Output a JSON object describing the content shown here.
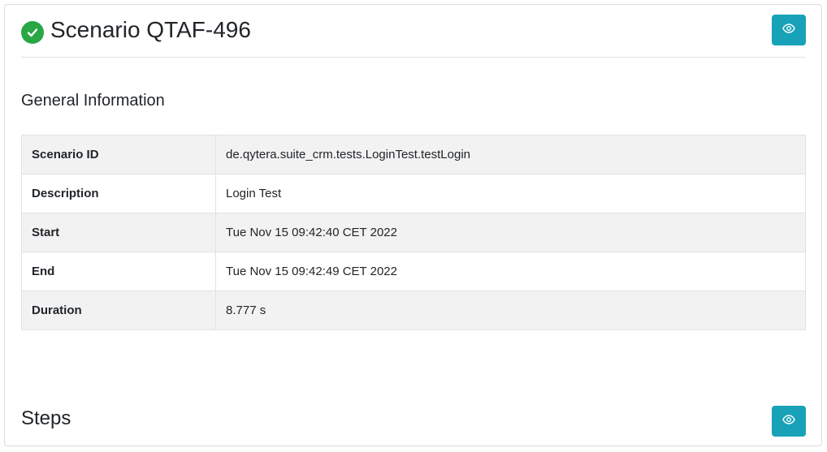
{
  "scenario": {
    "title": "Scenario QTAF-496",
    "status": "passed",
    "status_color": "#28a745",
    "status_icon": "check-circle-icon",
    "view_button_icon": "eye-icon"
  },
  "general_information": {
    "heading": "General Information",
    "rows": [
      {
        "key": "Scenario ID",
        "value": "de.qytera.suite_crm.tests.LoginTest.testLogin"
      },
      {
        "key": "Description",
        "value": "Login Test"
      },
      {
        "key": "Start",
        "value": "Tue Nov 15 09:42:40 CET 2022"
      },
      {
        "key": "End",
        "value": "Tue Nov 15 09:42:49 CET 2022"
      },
      {
        "key": "Duration",
        "value": "8.777 s"
      }
    ]
  },
  "steps": {
    "heading": "Steps",
    "view_button_icon": "eye-icon"
  },
  "colors": {
    "accent": "#17a2b8",
    "success": "#28a745",
    "stripe": "#f2f2f2"
  }
}
